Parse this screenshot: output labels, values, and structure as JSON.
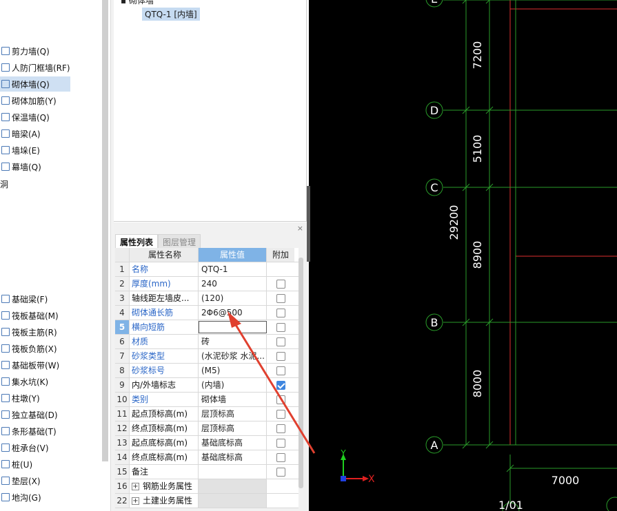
{
  "nav": {
    "items": [
      {
        "label": "剪力墙(Q)",
        "icon": "shear-wall-icon"
      },
      {
        "label": "人防门框墙(RF)",
        "icon": "civil-defense-door-wall-icon"
      },
      {
        "label": "砌体墙(Q)",
        "icon": "masonry-wall-icon",
        "selected": true
      },
      {
        "label": "砌体加筋(Y)",
        "icon": "masonry-rebar-icon"
      },
      {
        "label": "保温墙(Q)",
        "icon": "insulation-wall-icon"
      },
      {
        "label": "暗梁(A)",
        "icon": "hidden-beam-icon"
      },
      {
        "label": "墙垛(E)",
        "icon": "wall-pier-icon"
      },
      {
        "label": "幕墙(Q)",
        "icon": "curtain-wall-icon"
      }
    ],
    "group_label": "洞",
    "foundation_items": [
      {
        "label": "基础梁(F)",
        "icon": "foundation-beam-icon"
      },
      {
        "label": "筏板基础(M)",
        "icon": "raft-foundation-icon"
      },
      {
        "label": "筏板主筋(R)",
        "icon": "raft-main-rebar-icon"
      },
      {
        "label": "筏板负筋(X)",
        "icon": "raft-negative-rebar-icon"
      },
      {
        "label": "基础板带(W)",
        "icon": "foundation-strip-icon"
      },
      {
        "label": "集水坑(K)",
        "icon": "sump-pit-icon"
      },
      {
        "label": "柱墩(Y)",
        "icon": "column-pier-icon"
      },
      {
        "label": "独立基础(D)",
        "icon": "isolated-foundation-icon"
      },
      {
        "label": "条形基础(T)",
        "icon": "strip-foundation-icon"
      },
      {
        "label": "桩承台(V)",
        "icon": "pile-cap-icon"
      },
      {
        "label": "桩(U)",
        "icon": "pile-icon"
      },
      {
        "label": "垫层(X)",
        "icon": "cushion-layer-icon"
      },
      {
        "label": "地沟(G)",
        "icon": "trench-icon"
      }
    ]
  },
  "tree": {
    "parent_label": "砌体墙",
    "item_label": "QTQ-1 [内墙]"
  },
  "props": {
    "close_label": "×",
    "tabs": [
      {
        "label": "属性列表",
        "active": true
      },
      {
        "label": "图层管理",
        "active": false
      }
    ],
    "headers": {
      "name": "属性名称",
      "value": "属性值",
      "add": "附加"
    },
    "rows": [
      {
        "num": "1",
        "name": "名称",
        "value": "QTQ-1",
        "blue": true,
        "checkbox": "none"
      },
      {
        "num": "2",
        "name": "厚度(mm)",
        "value": "240",
        "blue": true,
        "checkbox": "empty"
      },
      {
        "num": "3",
        "name": "轴线距左墙皮...",
        "value": "(120)",
        "blue": false,
        "checkbox": "empty"
      },
      {
        "num": "4",
        "name": "砌体通长筋",
        "value": "2Φ6@500",
        "blue": true,
        "checkbox": "empty"
      },
      {
        "num": "5",
        "name": "横向短筋",
        "value": "",
        "blue": true,
        "checkbox": "empty",
        "editing": true
      },
      {
        "num": "6",
        "name": "材质",
        "value": "砖",
        "blue": true,
        "checkbox": "empty"
      },
      {
        "num": "7",
        "name": "砂浆类型",
        "value": "(水泥砂浆 水泥...",
        "blue": true,
        "checkbox": "empty"
      },
      {
        "num": "8",
        "name": "砂浆标号",
        "value": "(M5)",
        "blue": true,
        "checkbox": "empty"
      },
      {
        "num": "9",
        "name": "内/外墙标志",
        "value": "(内墙)",
        "blue": false,
        "checkbox": "checked"
      },
      {
        "num": "10",
        "name": "类别",
        "value": "砌体墙",
        "blue": true,
        "checkbox": "empty"
      },
      {
        "num": "11",
        "name": "起点顶标高(m)",
        "value": "层顶标高",
        "blue": false,
        "checkbox": "empty"
      },
      {
        "num": "12",
        "name": "终点顶标高(m)",
        "value": "层顶标高",
        "blue": false,
        "checkbox": "empty"
      },
      {
        "num": "13",
        "name": "起点底标高(m)",
        "value": "基础底标高",
        "blue": false,
        "checkbox": "empty"
      },
      {
        "num": "14",
        "name": "终点底标高(m)",
        "value": "基础底标高",
        "blue": false,
        "checkbox": "empty"
      },
      {
        "num": "15",
        "name": "备注",
        "value": "",
        "blue": false,
        "checkbox": "empty"
      },
      {
        "num": "16",
        "name": "钢筋业务属性",
        "value": "",
        "blue": false,
        "checkbox": "none",
        "group": true
      },
      {
        "num": "22",
        "name": "土建业务属性",
        "value": "",
        "blue": false,
        "checkbox": "none",
        "group": true
      }
    ]
  },
  "cad": {
    "axes": [
      {
        "label": "E"
      },
      {
        "label": "D"
      },
      {
        "label": "C"
      },
      {
        "label": "B"
      },
      {
        "label": "A"
      }
    ],
    "dimensions": {
      "segments": [
        "7200",
        "5100",
        "8900",
        "8000"
      ],
      "total": "29200",
      "horizontal": "7000"
    },
    "bottom_axis_label": "1/01",
    "ucs": {
      "x_label": "X",
      "y_label": "Y"
    },
    "colors": {
      "axis_line": "#2a9d2a",
      "wall_line": "#e03030",
      "annotation_arrow": "#e0402f",
      "text": "#ffffff"
    }
  }
}
